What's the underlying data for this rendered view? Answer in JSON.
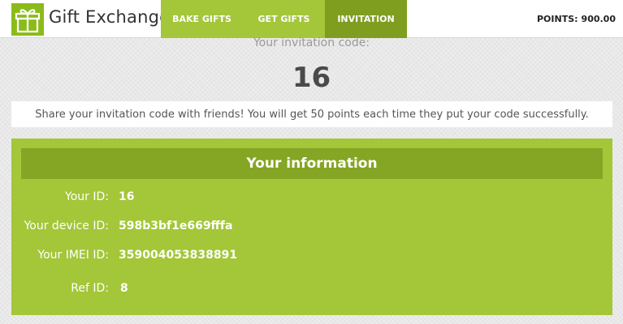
{
  "app": {
    "title": "Gift Exchange",
    "logo_icon": "gift-icon",
    "accent_color": "#a4c639",
    "active_tab_color": "#7f9e20"
  },
  "tabs": [
    {
      "label": "BAKE GIFTS",
      "active": false
    },
    {
      "label": "GET GIFTS",
      "active": false
    },
    {
      "label": "INVITATION",
      "active": true
    }
  ],
  "points": {
    "label": "POINTS:",
    "value": "900.00"
  },
  "invitation": {
    "label": "Your invitation code:",
    "code": "16",
    "share_text": "Share your invitation code with friends! You will get 50 points each time they put your code successfully."
  },
  "info": {
    "title": "Your information",
    "rows": [
      {
        "label": "Your ID:",
        "value": "16"
      },
      {
        "label": "Your device ID:",
        "value": "598b3bf1e669fffa"
      },
      {
        "label": "Your IMEI ID:",
        "value": "359004053838891"
      },
      {
        "label": "Ref ID:",
        "value": "8"
      }
    ]
  }
}
